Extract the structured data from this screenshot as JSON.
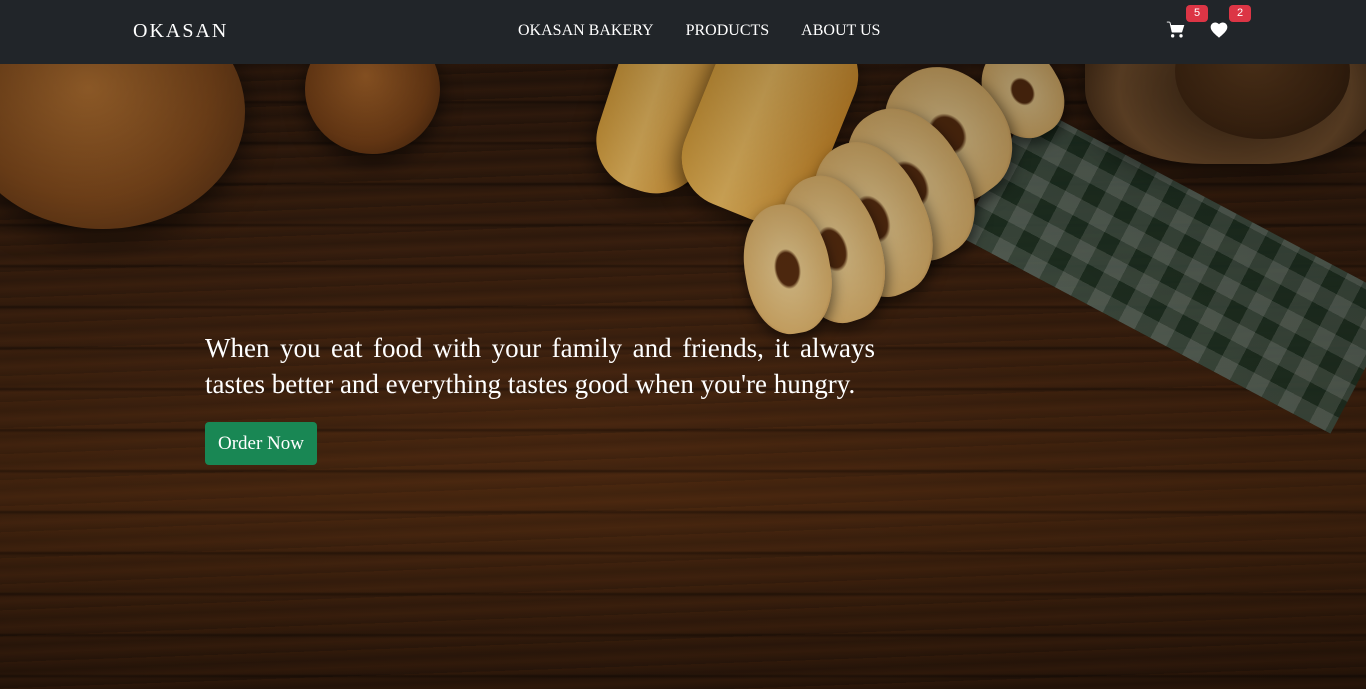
{
  "navbar": {
    "brand": "OKASAN",
    "links": [
      {
        "label": "OKASAN BAKERY"
      },
      {
        "label": "PRODUCTS"
      },
      {
        "label": "ABOUT US"
      }
    ],
    "cart": {
      "icon": "cart-icon",
      "count": "5"
    },
    "wishlist": {
      "icon": "heart-icon",
      "count": "2"
    }
  },
  "hero": {
    "text": "When you eat food with your family and friends, it always tastes better and everything tastes good when you're hungry.",
    "button_label": "Order Now",
    "background_image": "bread on dark wooden table"
  },
  "colors": {
    "navbar": "#212529",
    "badge": "#dc3545",
    "button": "#198754",
    "text": "#ffffff"
  }
}
